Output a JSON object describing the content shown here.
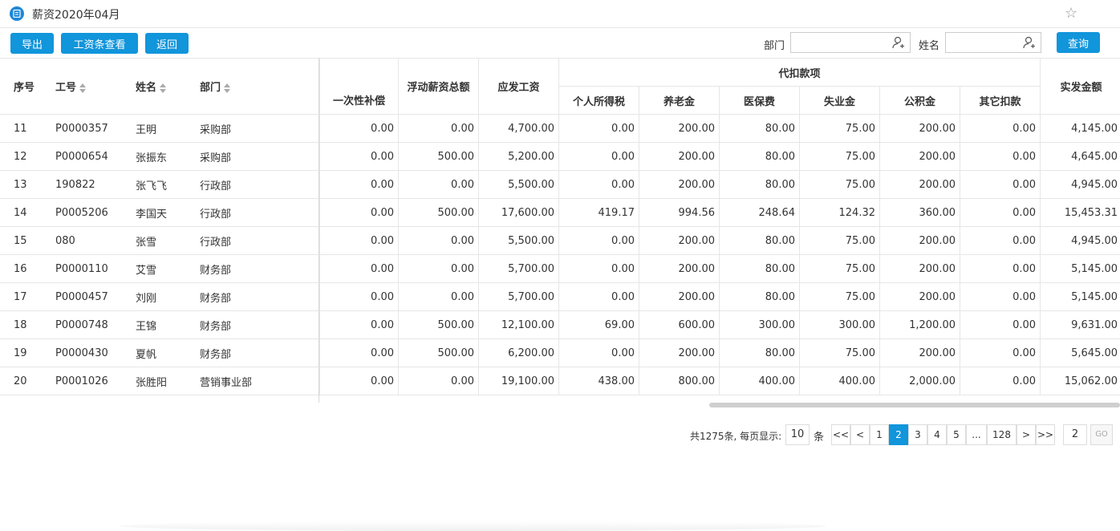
{
  "window": {
    "title": "薪资2020年04月"
  },
  "toolbar": {
    "export_label": "导出",
    "payslip_label": "工资条查看",
    "back_label": "返回",
    "dept_label": "部门",
    "dept_value": "",
    "name_label": "姓名",
    "name_value": "",
    "query_label": "查询"
  },
  "table": {
    "headers": {
      "seq": "序号",
      "emp_id": "工号",
      "name": "姓名",
      "dept": "部门",
      "lump": "一次性补偿",
      "float_total": "浮动薪资总额",
      "gross": "应发工资",
      "deduction_group": "代扣款项",
      "tax": "个人所得税",
      "pension": "养老金",
      "medical": "医保费",
      "unemployment": "失业金",
      "housing": "公积金",
      "other": "其它扣款",
      "net": "实发金额"
    },
    "rows": [
      {
        "seq": "11",
        "emp_id": "P0000357",
        "name": "王明",
        "dept": "采购部",
        "lump": "0.00",
        "float_total": "0.00",
        "gross": "4,700.00",
        "tax": "0.00",
        "pension": "200.00",
        "medical": "80.00",
        "unemployment": "75.00",
        "housing": "200.00",
        "other": "0.00",
        "net": "4,145.00"
      },
      {
        "seq": "12",
        "emp_id": "P0000654",
        "name": "张振东",
        "dept": "采购部",
        "lump": "0.00",
        "float_total": "500.00",
        "gross": "5,200.00",
        "tax": "0.00",
        "pension": "200.00",
        "medical": "80.00",
        "unemployment": "75.00",
        "housing": "200.00",
        "other": "0.00",
        "net": "4,645.00"
      },
      {
        "seq": "13",
        "emp_id": "190822",
        "name": "张飞飞",
        "dept": "行政部",
        "lump": "0.00",
        "float_total": "0.00",
        "gross": "5,500.00",
        "tax": "0.00",
        "pension": "200.00",
        "medical": "80.00",
        "unemployment": "75.00",
        "housing": "200.00",
        "other": "0.00",
        "net": "4,945.00"
      },
      {
        "seq": "14",
        "emp_id": "P0005206",
        "name": "李国天",
        "dept": "行政部",
        "lump": "0.00",
        "float_total": "500.00",
        "gross": "17,600.00",
        "tax": "419.17",
        "pension": "994.56",
        "medical": "248.64",
        "unemployment": "124.32",
        "housing": "360.00",
        "other": "0.00",
        "net": "15,453.31"
      },
      {
        "seq": "15",
        "emp_id": "080",
        "name": "张雪",
        "dept": "行政部",
        "lump": "0.00",
        "float_total": "0.00",
        "gross": "5,500.00",
        "tax": "0.00",
        "pension": "200.00",
        "medical": "80.00",
        "unemployment": "75.00",
        "housing": "200.00",
        "other": "0.00",
        "net": "4,945.00"
      },
      {
        "seq": "16",
        "emp_id": "P0000110",
        "name": "艾雪",
        "dept": "财务部",
        "lump": "0.00",
        "float_total": "0.00",
        "gross": "5,700.00",
        "tax": "0.00",
        "pension": "200.00",
        "medical": "80.00",
        "unemployment": "75.00",
        "housing": "200.00",
        "other": "0.00",
        "net": "5,145.00"
      },
      {
        "seq": "17",
        "emp_id": "P0000457",
        "name": "刘刚",
        "dept": "财务部",
        "lump": "0.00",
        "float_total": "0.00",
        "gross": "5,700.00",
        "tax": "0.00",
        "pension": "200.00",
        "medical": "80.00",
        "unemployment": "75.00",
        "housing": "200.00",
        "other": "0.00",
        "net": "5,145.00"
      },
      {
        "seq": "18",
        "emp_id": "P0000748",
        "name": "王锦",
        "dept": "财务部",
        "lump": "0.00",
        "float_total": "500.00",
        "gross": "12,100.00",
        "tax": "69.00",
        "pension": "600.00",
        "medical": "300.00",
        "unemployment": "300.00",
        "housing": "1,200.00",
        "other": "0.00",
        "net": "9,631.00"
      },
      {
        "seq": "19",
        "emp_id": "P0000430",
        "name": "夏帆",
        "dept": "财务部",
        "lump": "0.00",
        "float_total": "500.00",
        "gross": "6,200.00",
        "tax": "0.00",
        "pension": "200.00",
        "medical": "80.00",
        "unemployment": "75.00",
        "housing": "200.00",
        "other": "0.00",
        "net": "5,645.00"
      },
      {
        "seq": "20",
        "emp_id": "P0001026",
        "name": "张胜阳",
        "dept": "营销事业部",
        "lump": "0.00",
        "float_total": "0.00",
        "gross": "19,100.00",
        "tax": "438.00",
        "pension": "800.00",
        "medical": "400.00",
        "unemployment": "400.00",
        "housing": "2,000.00",
        "other": "0.00",
        "net": "15,062.00"
      }
    ]
  },
  "pager": {
    "total_text": "共1275条, 每页显示:",
    "page_size": "10",
    "unit": "条",
    "first": "<<",
    "prev": "<",
    "pages": [
      "1",
      "2",
      "3",
      "4",
      "5"
    ],
    "current": "2",
    "ellipsis": "...",
    "last_page": "128",
    "next": ">",
    "last": ">>",
    "jump_value": "2",
    "go_label": "GO"
  },
  "colors": {
    "accent": "#1195db",
    "border": "#e6e6e6"
  }
}
